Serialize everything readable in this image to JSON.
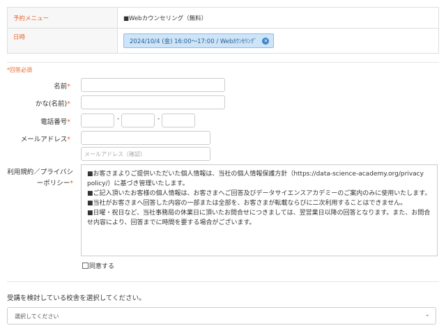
{
  "summary": {
    "menu_label": "予約メニュー",
    "menu_value": "■Webカウンセリング（無料）",
    "datetime_label": "日時",
    "datetime_value": "2024/10/4 (金) 16:00〜17:00  / Webｶｳﾝｾﾘﾝｸﾞ",
    "remove_icon": "✕"
  },
  "form": {
    "required_note": "*回答必須",
    "name_label": "名前",
    "kana_label": "かな(名前)",
    "phone_label": "電話番号",
    "phone_sep": "-",
    "email_label": "メールアドレス",
    "email_confirm_placeholder": "メールアドレス（確認）",
    "required_mark": "*",
    "policy_label": "利用規約／プライバシーポリシー",
    "policy_paragraphs": [
      "■お客さまよりご提供いただいた個人情報は、当社の個人情報保護方針（https://data-science-academy.org/privacy policy/）に基づき管理いたします。",
      "■ご記入頂いたお客様の個人情報は、お客さまへご回答及びデータサイエンスアカデミーのご案内のみに使用いたします。",
      "■当社がお客さまへ回答した内容の一部または全部を、お客さまが転載ならびに二次利用することはできません。",
      "■日曜・祝日など、当社事務局の休業日に頂いたお問合せにつきましては、翌営業日以降の回答となります。また、お問合せ内容により、回答までに時間を要する場合がございます。"
    ],
    "agree_label": "同意する",
    "school_question": "受講を検討している校舎を選択してください。",
    "school_select_value": "選択してください"
  },
  "colors": {
    "accent": "#e8662c",
    "tag_bg": "#cde4f9",
    "tag_icon": "#3f86c9"
  }
}
